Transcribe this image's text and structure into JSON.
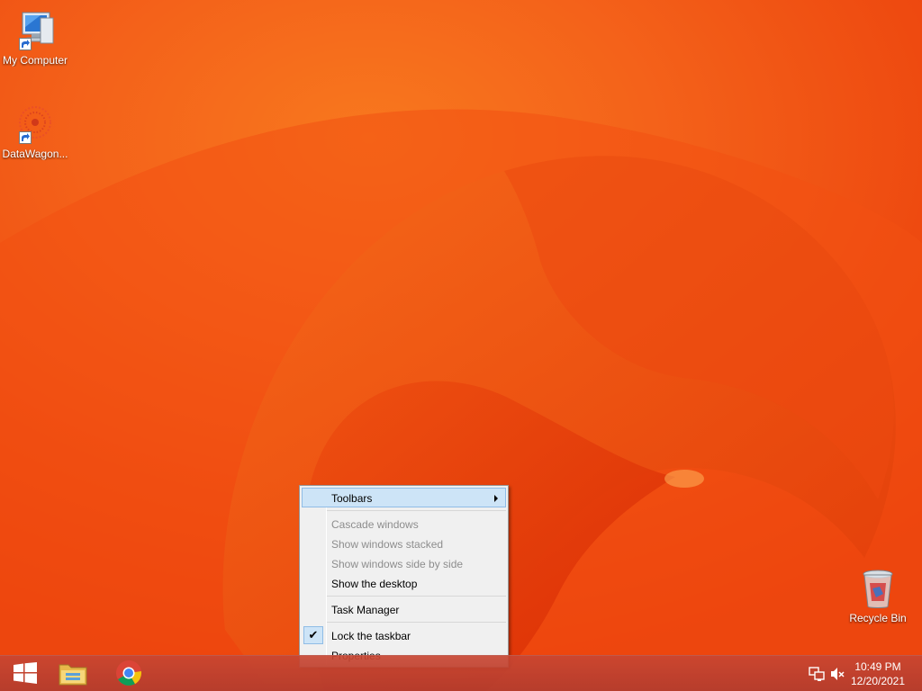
{
  "desktop": {
    "icons": [
      {
        "label": "My Computer",
        "icon": "computer-icon"
      },
      {
        "label": "DataWagon...",
        "icon": "datawagon-icon"
      },
      {
        "label": "Recycle Bin",
        "icon": "recycle-bin-icon"
      }
    ]
  },
  "context_menu": {
    "items": [
      {
        "label": "Toolbars",
        "state": "highlighted",
        "has_submenu": true
      },
      {
        "label": "Cascade windows",
        "state": "disabled"
      },
      {
        "label": "Show windows stacked",
        "state": "disabled"
      },
      {
        "label": "Show windows side by side",
        "state": "disabled"
      },
      {
        "label": "Show the desktop",
        "state": "enabled"
      },
      {
        "label": "Task Manager",
        "state": "enabled"
      },
      {
        "label": "Lock the taskbar",
        "state": "checked",
        "check_glyph": "✔"
      },
      {
        "label": "Properties",
        "state": "enabled"
      }
    ]
  },
  "taskbar": {
    "buttons": [
      {
        "icon": "windows-start-icon"
      },
      {
        "icon": "file-explorer-icon"
      },
      {
        "icon": "chrome-icon"
      }
    ],
    "tray": {
      "icons": [
        "network-icon",
        "speaker-muted-icon"
      ],
      "time": "10:49 PM",
      "date": "12/20/2021"
    }
  },
  "colors": {
    "wallpaper": "#f25a14",
    "menu_bg": "#f0f0f0",
    "menu_highlight": "#cde4f7",
    "disabled_text": "#8d8d8d"
  }
}
